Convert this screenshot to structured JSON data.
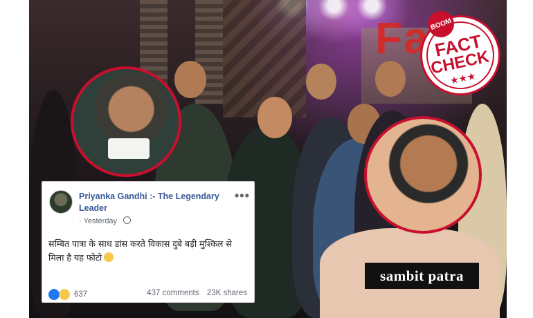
{
  "image": {
    "overlay_word": "Fake",
    "stamp": {
      "badge": "BOOM",
      "line1": "FACT",
      "line2": "CHECK",
      "stars": "★★★"
    },
    "caption": "sambit patra"
  },
  "post": {
    "author": "Priyanka Gandhi :- The Legendary Leader",
    "time": "Yesterday",
    "separator": "·",
    "text": "सम्बित पात्रा के साथ डांस करते विकास दुबे बड़ी मुश्किल से मिला है यह फोटो",
    "reaction_count": "637",
    "comments": "437 comments",
    "shares": "23K shares",
    "more_icon": "•••"
  },
  "colors": {
    "stamp_red": "#c8102e",
    "link_blue": "#385898",
    "like_blue": "#2078f4"
  }
}
